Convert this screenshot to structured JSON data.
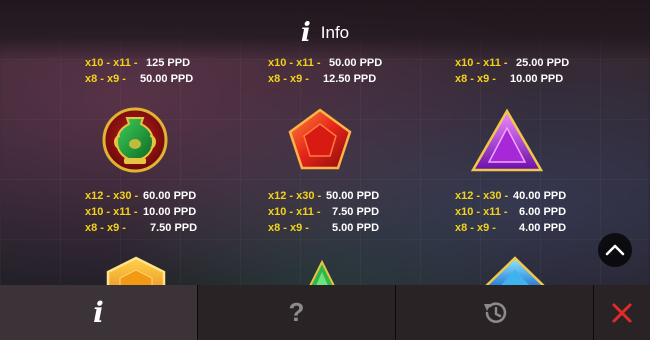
{
  "header": {
    "info_glyph": "i",
    "title": "Info"
  },
  "paytable": {
    "row1": [
      {
        "lines": [
          {
            "range": "x10 - x11 -",
            "value": "125 PPD"
          },
          {
            "range": "x8 - x9 -",
            "value": "50.00 PPD"
          }
        ]
      },
      {
        "lines": [
          {
            "range": "x10 - x11 -",
            "value": "50.00 PPD"
          },
          {
            "range": "x8 - x9 -",
            "value": "12.50 PPD"
          }
        ]
      },
      {
        "lines": [
          {
            "range": "x10 - x11 -",
            "value": "25.00 PPD"
          },
          {
            "range": "x8 - x9 -",
            "value": "10.00 PPD"
          }
        ]
      }
    ],
    "row2": [
      {
        "symbol": "vase-symbol",
        "lines": [
          {
            "range": "x12 - x30 -",
            "value": "60.00 PPD"
          },
          {
            "range": "x10 - x11 -",
            "value": "10.00 PPD"
          },
          {
            "range": "x8 - x9 -",
            "value": "7.50 PPD"
          }
        ]
      },
      {
        "symbol": "red-pentagon-gem",
        "lines": [
          {
            "range": "x12 - x30 -",
            "value": "50.00 PPD"
          },
          {
            "range": "x10 - x11 -",
            "value": "7.50 PPD"
          },
          {
            "range": "x8 - x9 -",
            "value": "5.00 PPD"
          }
        ]
      },
      {
        "symbol": "purple-triangle-gem",
        "lines": [
          {
            "range": "x12 - x30 -",
            "value": "40.00 PPD"
          },
          {
            "range": "x10 - x11 -",
            "value": "6.00 PPD"
          },
          {
            "range": "x8 - x9 -",
            "value": "4.00 PPD"
          }
        ]
      }
    ]
  },
  "footer": {
    "info_tab": "i",
    "help_tab": "?",
    "history_icon": "history-icon",
    "close_icon": "close-icon"
  },
  "colors": {
    "range_text": "#f2d21b",
    "value_text": "#ffffff",
    "close_red": "#e02b2b"
  }
}
